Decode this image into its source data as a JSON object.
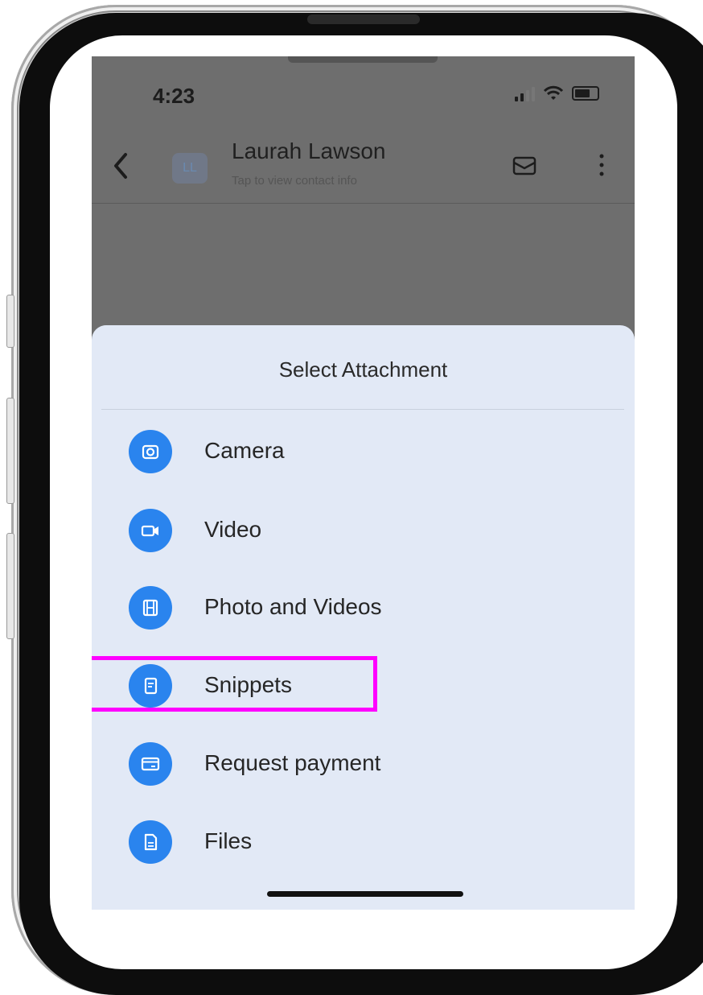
{
  "status_bar": {
    "time": "4:23"
  },
  "header": {
    "avatar_initials": "LL",
    "contact_name": "Laurah Lawson",
    "contact_subtitle": "Tap to view contact info"
  },
  "sheet": {
    "title": "Select Attachment",
    "items": [
      {
        "label": "Camera",
        "icon": "camera-icon"
      },
      {
        "label": "Video",
        "icon": "video-icon"
      },
      {
        "label": "Photo and Videos",
        "icon": "film-icon"
      },
      {
        "label": "Snippets",
        "icon": "snippet-icon",
        "highlighted": true
      },
      {
        "label": "Request payment",
        "icon": "payment-card-icon"
      },
      {
        "label": "Files",
        "icon": "file-icon"
      }
    ]
  },
  "colors": {
    "accent": "#2a84ee",
    "sheet_background": "#e2e9f6",
    "highlight": "#ff00ff",
    "overlay": "#6e6e6e"
  }
}
